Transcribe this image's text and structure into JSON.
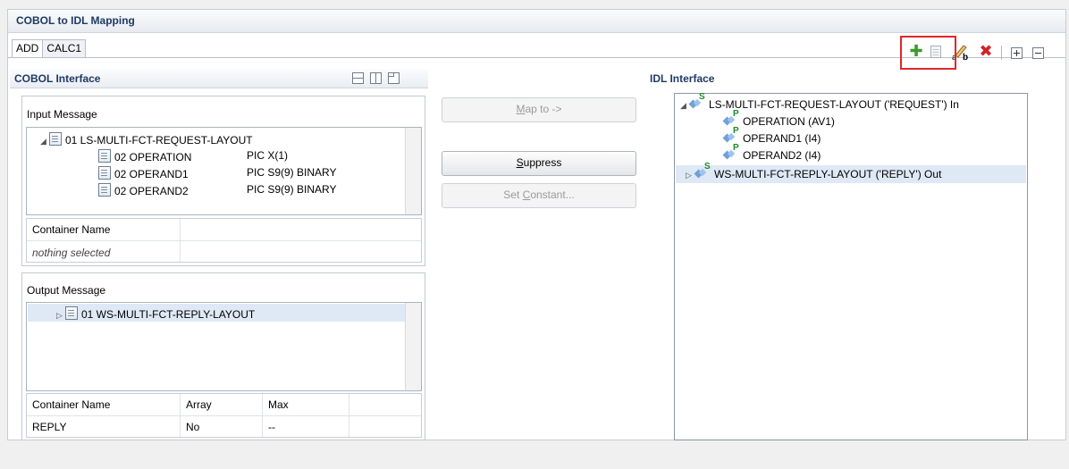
{
  "editor": {
    "title": "COBOL to IDL Mapping",
    "tabs": [
      "ADD",
      "CALC1"
    ]
  },
  "toolbar": {
    "icons": [
      "add-icon",
      "copy-icon",
      "rename-icon",
      "delete-icon",
      "expand-all-icon",
      "collapse-all-icon"
    ],
    "colors": {
      "add": "#3a9a2c",
      "delete": "#d0232a",
      "highlight": "#e0262c"
    }
  },
  "cobol": {
    "title": "COBOL Interface",
    "input": {
      "label": "Input Message",
      "tree": [
        {
          "name": "01 LS-MULTI-FCT-REQUEST-LAYOUT",
          "pic": ""
        },
        {
          "name": "02 OPERATION",
          "pic": "PIC X(1)"
        },
        {
          "name": "02 OPERAND1",
          "pic": "PIC S9(9) BINARY"
        },
        {
          "name": "02 OPERAND2",
          "pic": "PIC S9(9) BINARY"
        }
      ],
      "grid": {
        "header": "Container Name",
        "value": "nothing selected"
      }
    },
    "output": {
      "label": "Output Message",
      "tree": [
        {
          "name": "01 WS-MULTI-FCT-REPLY-LAYOUT"
        }
      ],
      "grid": {
        "headers": [
          "Container Name",
          "Array",
          "Max"
        ],
        "row": [
          "REPLY",
          "No",
          "--"
        ]
      }
    }
  },
  "actions": {
    "map_to_prefix": "M",
    "map_to_rest": "ap to ->",
    "suppress_prefix": "S",
    "suppress_rest": "uppress",
    "set_constant_prefix": "Set ",
    "set_constant_key": "C",
    "set_constant_rest": "onstant..."
  },
  "idl": {
    "title": "IDL Interface",
    "tree": [
      {
        "name": "LS-MULTI-FCT-REQUEST-LAYOUT  ('REQUEST') In",
        "badge": "S"
      },
      {
        "name": "OPERATION  (AV1)",
        "badge": "P"
      },
      {
        "name": "OPERAND1  (I4)",
        "badge": "P"
      },
      {
        "name": "OPERAND2  (I4)",
        "badge": "P"
      },
      {
        "name": "WS-MULTI-FCT-REPLY-LAYOUT  ('REPLY')  Out",
        "badge": "S"
      }
    ]
  }
}
